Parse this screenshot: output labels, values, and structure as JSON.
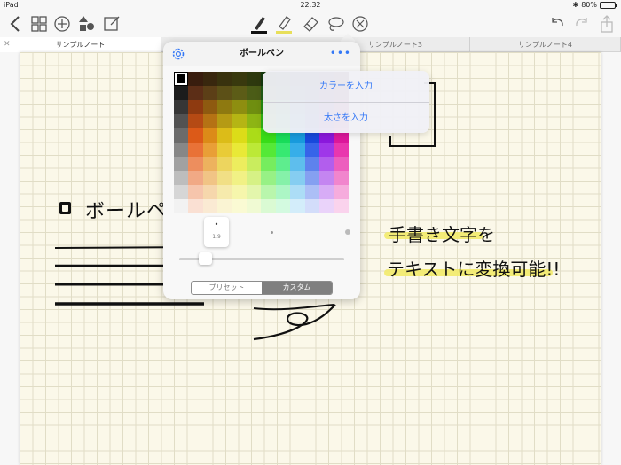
{
  "status_bar": {
    "device": "iPad",
    "time": "22:32",
    "battery": "80%",
    "battery_level": 0.8
  },
  "toolbar": {
    "left_icons": [
      "back-chevron-icon",
      "grid-icon",
      "add-icon",
      "shapes-icon",
      "edit-icon"
    ],
    "center_icons": [
      "pen-tool-icon",
      "highlighter-tool-icon",
      "eraser-tool-icon",
      "lasso-tool-icon",
      "close-circle-icon"
    ],
    "right_icons": [
      "undo-icon",
      "redo-icon",
      "share-icon"
    ],
    "pen_underline_color": "#111111",
    "highlighter_underline_color": "#e8df5a"
  },
  "tabs": [
    {
      "label": "サンプルノート",
      "active": true
    },
    {
      "label": "サンプルノート3",
      "active": false
    },
    {
      "label": "サンプルノート4",
      "active": false
    }
  ],
  "note": {
    "handwritten_label": "ボールペン",
    "handwritten_line1": "手書き文字を",
    "handwritten_line2": "テキストに変換可能!!",
    "highlight_color": "#f2ea6a"
  },
  "popover": {
    "title": "ボールペン",
    "more_label": "•••",
    "selected_color": "#000000",
    "pen_size": "1.9",
    "segments": [
      {
        "label": "プリセット",
        "active": false
      },
      {
        "label": "カスタム",
        "active": true
      }
    ]
  },
  "menu": {
    "items": [
      {
        "label": "カラーを入力"
      },
      {
        "label": "太さを入力"
      }
    ]
  }
}
